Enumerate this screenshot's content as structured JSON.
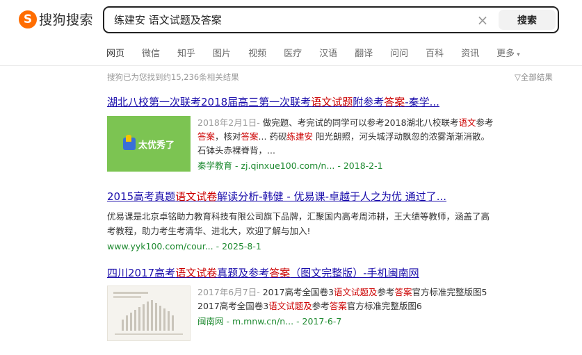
{
  "logo": {
    "mark": "S",
    "text": "搜狗搜索"
  },
  "search": {
    "query": "练建安 语文试题及答案",
    "clear": "×",
    "button": "搜索"
  },
  "tabs": [
    "网页",
    "微信",
    "知乎",
    "图片",
    "视频",
    "医疗",
    "汉语",
    "翻译",
    "问问",
    "百科",
    "资讯",
    "更多"
  ],
  "more_arrow": "▾",
  "stats": "搜狗已为您找到约15,236条相关结果",
  "filter": {
    "icon": "▽",
    "label": "全部结果"
  },
  "results": [
    {
      "title": [
        {
          "t": "湖北八校第一次联考2018届高三第一次联考"
        },
        {
          "t": "语文试题",
          "hl": true
        },
        {
          "t": "附参考"
        },
        {
          "t": "答案",
          "hl": true
        },
        {
          "t": "-秦学..."
        }
      ],
      "thumbnail": {
        "type": "badge",
        "text": "太优秀了",
        "icon": "thumbs-up-icon"
      },
      "date": "2018年2月1日-",
      "snippet": [
        {
          "t": " 做完题、考完试的同学可以参考2018湖北八校联考"
        },
        {
          "t": "语文",
          "hl": true
        },
        {
          "t": "参考"
        },
        {
          "t": "答案",
          "hl": true
        },
        {
          "t": "，核对"
        },
        {
          "t": "答案",
          "hl": true
        },
        {
          "t": "... 药砚"
        },
        {
          "t": "练建安",
          "hl": true
        },
        {
          "t": " 阳光朗照，河头城浮动飘忽的浓雾渐渐消散。 石钵头赤裸脊背，..."
        }
      ],
      "source": "秦学教育 - zj.qinxue100.com/n... - 2018-2-1"
    },
    {
      "title": [
        {
          "t": "2015高考真题"
        },
        {
          "t": "语文试卷",
          "hl": true
        },
        {
          "t": "解读分析-韩健 - 优易课-卓越于人之为优 通过了..."
        }
      ],
      "snippet": [
        {
          "t": "优易课是北京卓铭助力教育科技有限公司旗下品牌，汇聚国内高考周沛耕，王大绩等教师，涵盖了高考教程，助力考生考清华、进北大，欢迎了解与加入!"
        }
      ],
      "source": "www.yyk100.com/cour... - 2025-8-1"
    },
    {
      "title": [
        {
          "t": "四川2017高考"
        },
        {
          "t": "语文试卷",
          "hl": true
        },
        {
          "t": "真题及参考"
        },
        {
          "t": "答案",
          "hl": true
        },
        {
          "t": "（图文完整版）-手机闽南网"
        }
      ],
      "thumbnail": {
        "type": "document",
        "icon": "document-chart-icon"
      },
      "date": "2017年6月7日-",
      "snippet": [
        {
          "t": " 2017高考全国卷3"
        },
        {
          "t": "语文试题及",
          "hl": true
        },
        {
          "t": "参考"
        },
        {
          "t": "答案",
          "hl": true
        },
        {
          "t": "官方标准完整版图5 2017高考全国卷3"
        },
        {
          "t": "语文试题及",
          "hl": true
        },
        {
          "t": "参考"
        },
        {
          "t": "答案",
          "hl": true
        },
        {
          "t": "官方标准完整版图6"
        }
      ],
      "source": "闽南网 - m.mnw.cn/n... - 2017-6-7"
    }
  ]
}
